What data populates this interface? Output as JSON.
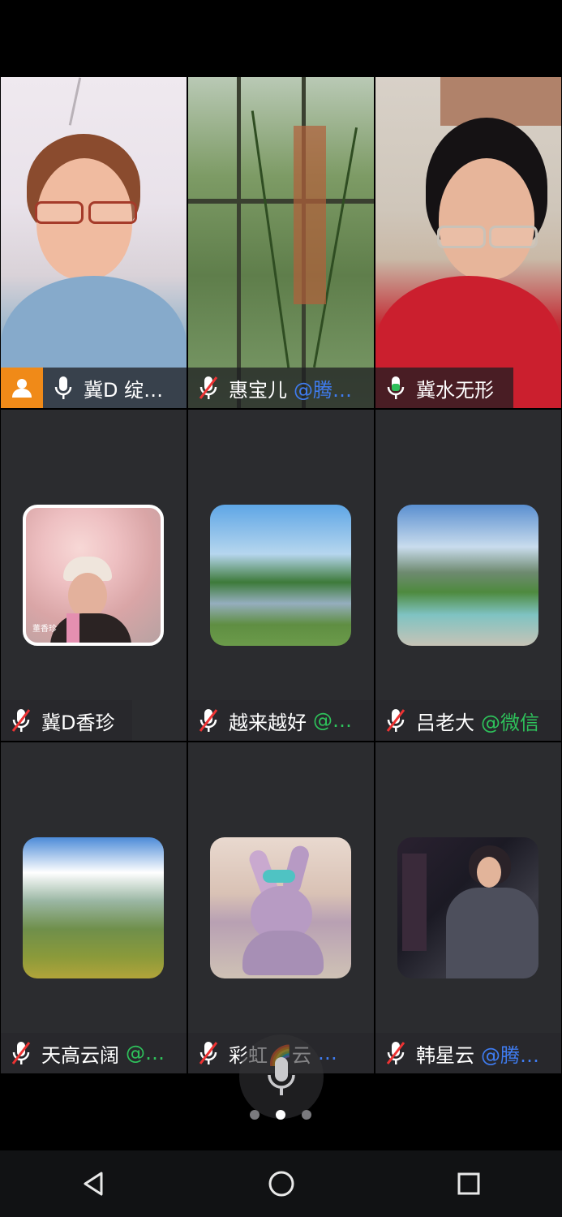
{
  "participants": [
    {
      "name": "冀D 绽…",
      "source": "",
      "mic": "on",
      "host": true,
      "type": "video"
    },
    {
      "name": "惠宝儿",
      "source": "@腾…",
      "source_color": "#3f7cf0",
      "mic": "muted",
      "type": "video"
    },
    {
      "name": "冀水无形",
      "source": "",
      "mic": "on",
      "type": "video",
      "active_speaker": true
    },
    {
      "name": "冀D香珍",
      "source": "",
      "mic": "muted",
      "type": "avatar",
      "avatar_caption": "董香珍"
    },
    {
      "name": "越来越好",
      "source": "@…",
      "source_color": "#2ec25b",
      "mic": "muted",
      "type": "avatar"
    },
    {
      "name": "吕老大",
      "source": "@微信",
      "source_color": "#2ec25b",
      "mic": "muted",
      "type": "avatar"
    },
    {
      "name": "天高云阔",
      "source": "@…",
      "source_color": "#2ec25b",
      "mic": "muted",
      "type": "avatar"
    },
    {
      "name": "彩虹🌈云",
      "source": "…",
      "source_color": "#3f7cf0",
      "mic": "muted",
      "type": "avatar"
    },
    {
      "name": "韩星云",
      "source": "@腾…",
      "source_color": "#3f7cf0",
      "mic": "muted",
      "type": "avatar"
    }
  ],
  "pager": {
    "pages": 3,
    "current": 2
  },
  "navbar": {
    "icons": [
      "back-icon",
      "home-icon",
      "recents-icon"
    ]
  }
}
